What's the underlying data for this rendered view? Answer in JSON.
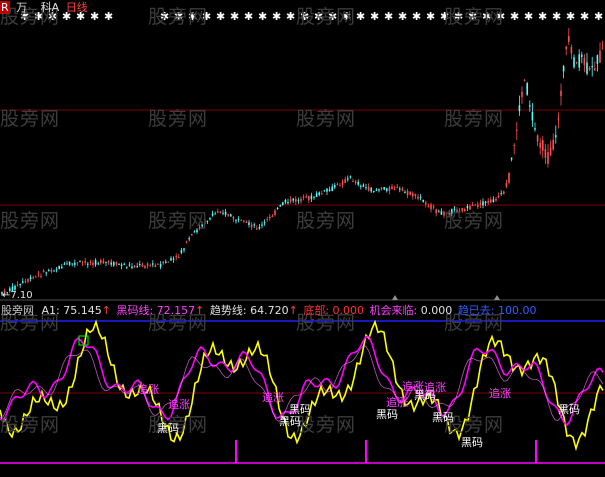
{
  "header": {
    "marker": "R",
    "name_part1": "万",
    "name_part2": "科A",
    "period": "日线"
  },
  "watermark": "股旁网",
  "price_low_label": "←7.10",
  "indicator_bar": {
    "source": "股旁网",
    "a1_label": "A1:",
    "a1_value": "75.145",
    "black_horse_label": "黑码线:",
    "black_horse_value": "72.157",
    "trend_label": "趋势线:",
    "trend_value": "64.720",
    "low_buy_label": "底部:",
    "low_buy_value": "0.000",
    "chance_label": "机会来临:",
    "chance_value": "0.000",
    "gone_label": "趋已去:",
    "gone_value": "100.00"
  },
  "signals": [
    {
      "text": "追涨",
      "color": "#ff40ff"
    },
    {
      "text": "追涨",
      "color": "#ff40ff"
    },
    {
      "text": "黑码",
      "color": "#ffffff"
    },
    {
      "text": "追涨",
      "color": "#ff40ff"
    },
    {
      "text": "黑码",
      "color": "#ffffff"
    },
    {
      "text": "黑码",
      "color": "#ffffff"
    },
    {
      "text": "追涨",
      "color": "#ff40ff"
    },
    {
      "text": "黑码",
      "color": "#ffffff"
    },
    {
      "text": "追涨",
      "color": "#ff40ff"
    },
    {
      "text": "黑码",
      "color": "#ffffff"
    },
    {
      "text": "追涨",
      "color": "#ff40ff"
    },
    {
      "text": "黑码",
      "color": "#ffffff"
    },
    {
      "text": "黑码",
      "color": "#ffffff"
    },
    {
      "text": "追涨",
      "color": "#ff40ff"
    },
    {
      "text": "黑码",
      "color": "#ffffff"
    }
  ],
  "colors": {
    "background": "#000000",
    "up_candle": "#ff5050",
    "down_candle": "#54fcfc",
    "grid": "#800000",
    "yellow_line": "#ffff00",
    "magenta_line": "#ff00ff",
    "blue_line": "#2020ff",
    "green_tag": "#00ff00"
  }
}
